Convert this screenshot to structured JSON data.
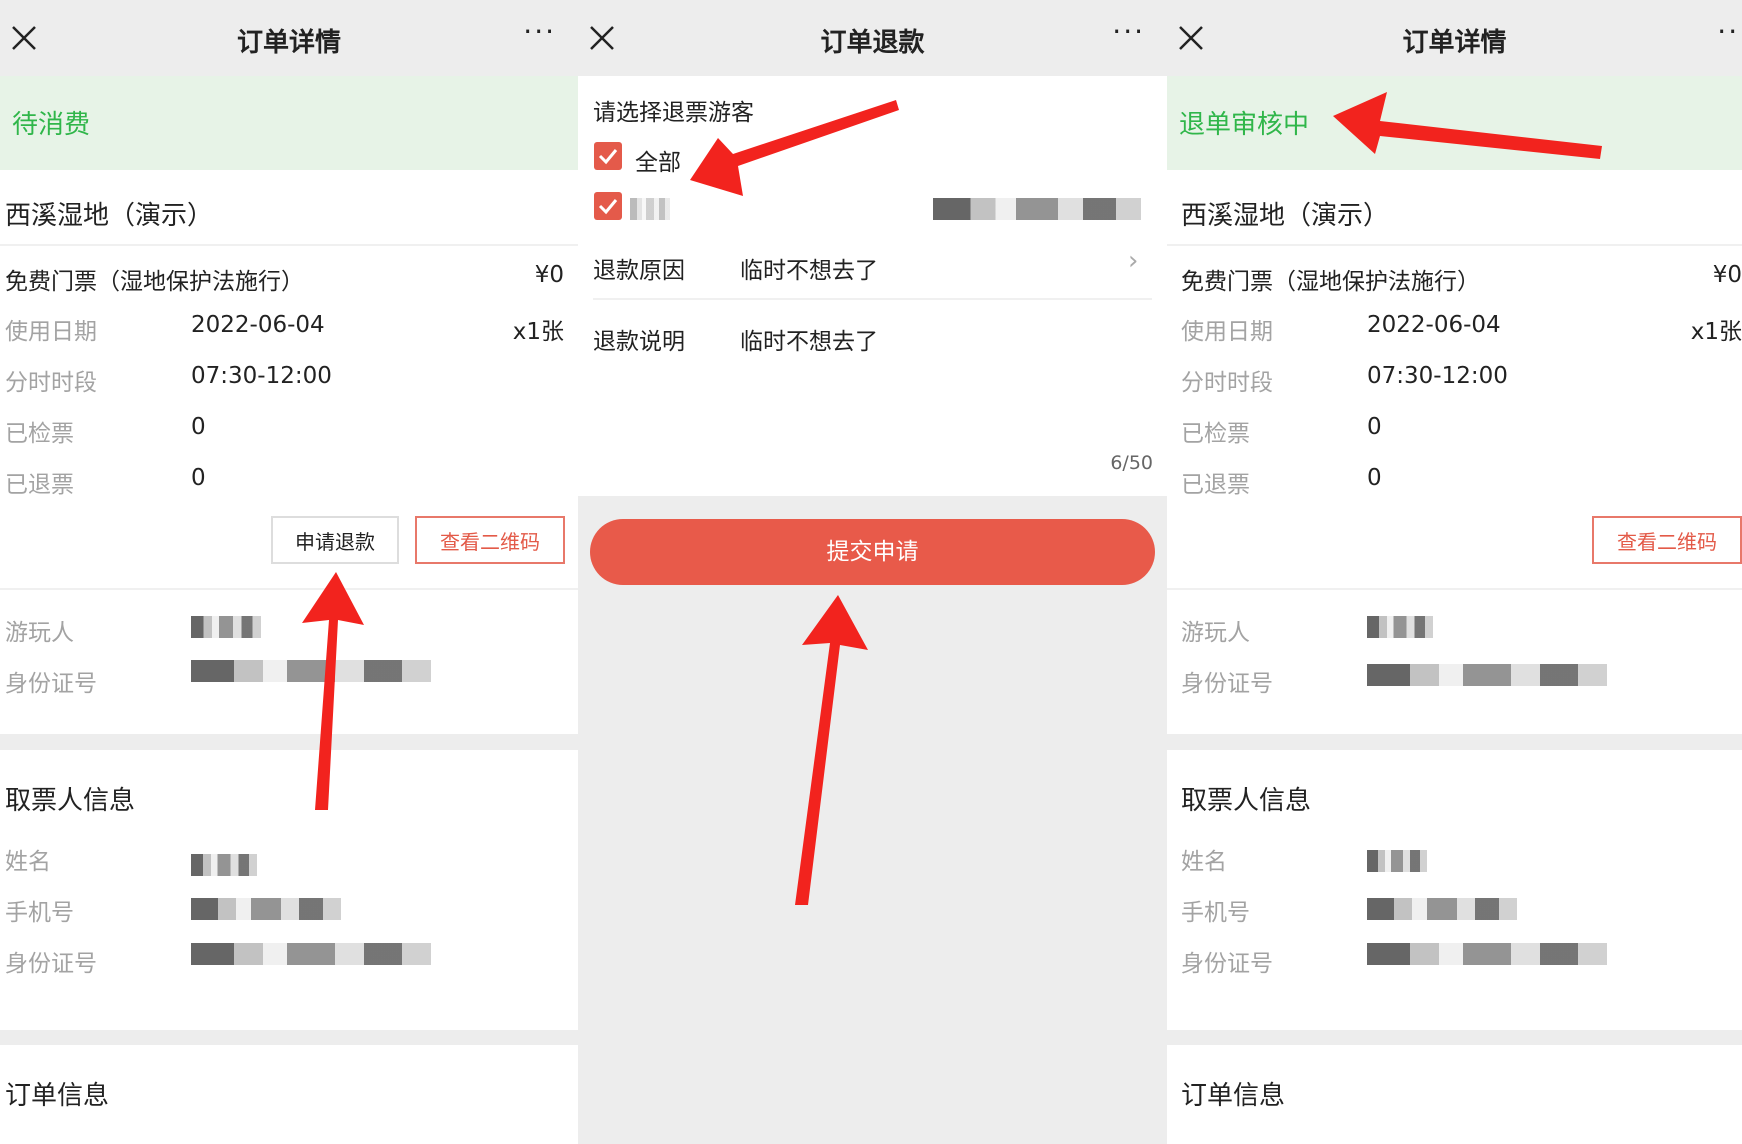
{
  "panels": [
    {
      "topbar": {
        "title": "订单详情",
        "more": "···"
      },
      "status": "待消费",
      "scenic_name": "西溪湿地（演示）",
      "ticket": {
        "name": "免费门票（湿地保护法施行）",
        "price": "¥0",
        "quantity": "x1张"
      },
      "details": [
        {
          "label": "使用日期",
          "value": "2022-06-04"
        },
        {
          "label": "分时时段",
          "value": "07:30-12:00"
        },
        {
          "label": "已检票",
          "value": "0"
        },
        {
          "label": "已退票",
          "value": "0"
        }
      ],
      "buttons": {
        "refund": "申请退款",
        "qrcode": "查看二维码"
      },
      "visitor": {
        "name_label": "游玩人",
        "id_label": "身份证号"
      },
      "picker": {
        "title": "取票人信息",
        "name_label": "姓名",
        "phone_label": "手机号",
        "id_label": "身份证号"
      },
      "order_info_title": "订单信息"
    },
    {
      "topbar": {
        "title": "订单退款",
        "more": "···"
      },
      "select_title": "请选择退票游客",
      "select_all": "全部",
      "reason_label": "退款原因",
      "reason_value": "临时不想去了",
      "desc_label": "退款说明",
      "desc_value": "临时不想去了",
      "counter": "6/50",
      "submit": "提交申请",
      "chevron": "›"
    },
    {
      "topbar": {
        "title": "订单详情",
        "more": "···"
      },
      "status": "退单审核中",
      "scenic_name": "西溪湿地（演示）",
      "ticket": {
        "name": "免费门票（湿地保护法施行）",
        "price": "¥0",
        "quantity": "x1张"
      },
      "details": [
        {
          "label": "使用日期",
          "value": "2022-06-04"
        },
        {
          "label": "分时时段",
          "value": "07:30-12:00"
        },
        {
          "label": "已检票",
          "value": "0"
        },
        {
          "label": "已退票",
          "value": "0"
        }
      ],
      "buttons": {
        "qrcode": "查看二维码"
      },
      "visitor": {
        "name_label": "游玩人",
        "id_label": "身份证号"
      },
      "picker": {
        "title": "取票人信息",
        "name_label": "姓名",
        "phone_label": "手机号",
        "id_label": "身份证号"
      },
      "order_info_title": "订单信息"
    }
  ],
  "colors": {
    "status_green": "#30b64a",
    "accent_red": "#e85a4a",
    "arrow_red": "#f2231e"
  }
}
